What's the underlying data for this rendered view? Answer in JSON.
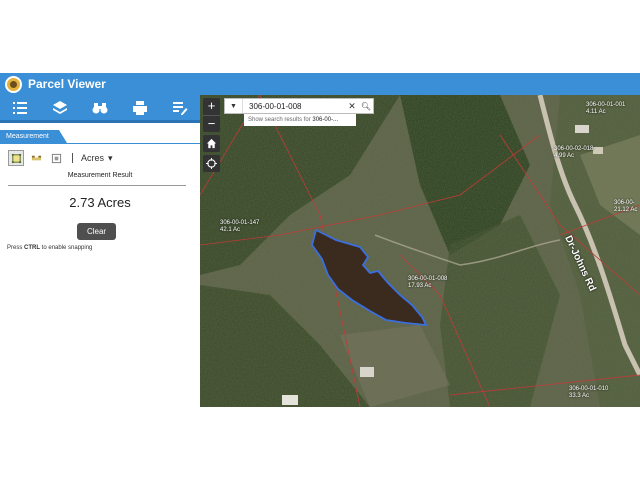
{
  "header": {
    "title": "Parcel Viewer"
  },
  "toolbar": {
    "items": [
      {
        "name": "list-icon"
      },
      {
        "name": "layers-icon"
      },
      {
        "name": "binoculars-icon"
      },
      {
        "name": "print-icon"
      },
      {
        "name": "edit-list-icon"
      }
    ]
  },
  "panel": {
    "tab_label": "Measurement",
    "unit": "Acres",
    "result_label": "Measurement Result",
    "result_value": "2.73 Acres",
    "clear_label": "Clear",
    "hint_prefix": "Press ",
    "hint_key": "CTRL",
    "hint_suffix": " to enable snapping"
  },
  "map": {
    "zoom_in": "+",
    "zoom_out": "−",
    "search_value": "306-00-01-008",
    "suggest_prefix": "Show search results for ",
    "suggest_term": "306-00-...",
    "road_name": "Dr-Johns Rd",
    "parcels": [
      {
        "id": "306-00-01-008",
        "acres": "17.93 Ac"
      },
      {
        "id": "306-00-01-147",
        "acres": "42.1 Ac"
      },
      {
        "id": "306-00-01-001",
        "acres": "4.11 Ac"
      },
      {
        "id": "306-00-02-018",
        "acres": "4.99 Ac"
      },
      {
        "id": "306-00-",
        "acres": "21.12 Ac"
      },
      {
        "id": "306-00-01-010",
        "acres": "33.3 Ac"
      }
    ]
  },
  "colors": {
    "accent": "#3a8fd6",
    "selection": "#3a6fe0"
  }
}
